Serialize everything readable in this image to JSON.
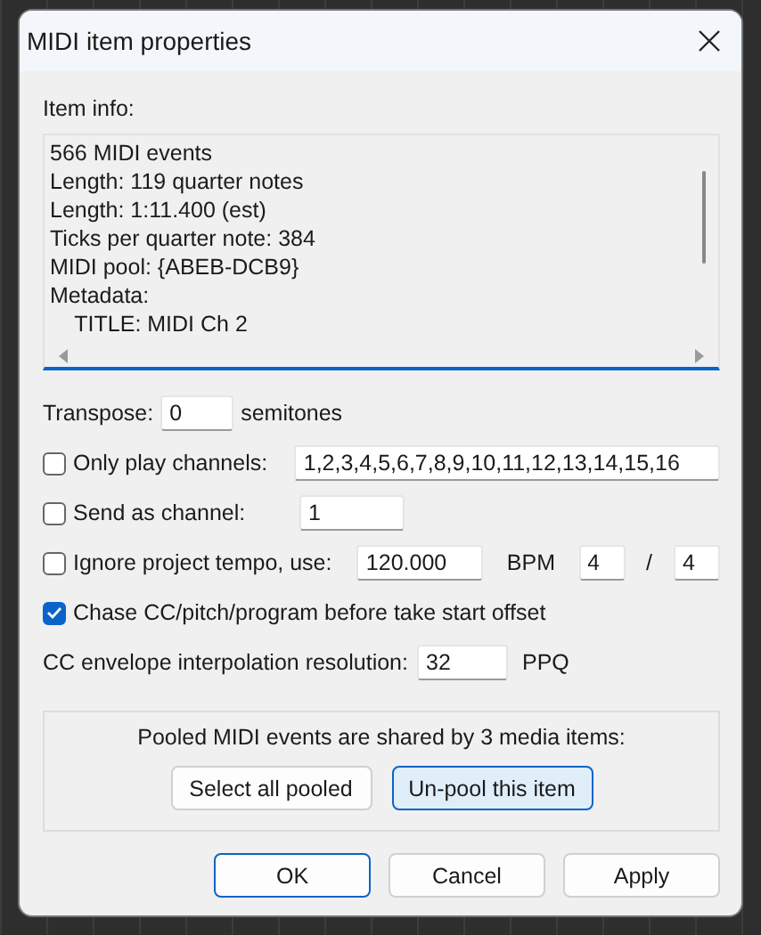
{
  "window": {
    "title": "MIDI item properties"
  },
  "item_info": {
    "label": "Item info:",
    "lines": [
      "566 MIDI events",
      "Length: 119 quarter notes",
      "Length: 1:11.400 (est)",
      "Ticks per quarter note: 384",
      "MIDI pool: {ABEB-DCB9}",
      "Metadata:",
      "    TITLE: MIDI Ch 2"
    ]
  },
  "transpose": {
    "label": "Transpose:",
    "value": "0",
    "unit": "semitones"
  },
  "options": [
    {
      "kind": "field",
      "checked": false,
      "label": "Only play channels:",
      "value": "1,2,3,4,5,6,7,8,9,10,11,12,13,14,15,16"
    },
    {
      "kind": "field",
      "checked": false,
      "label": "Send as channel:",
      "value": "1"
    },
    {
      "kind": "tempo",
      "checked": false,
      "label": "Ignore project tempo, use:",
      "bpm": "120.000",
      "bpm_unit": "BPM",
      "numerator": "4",
      "separator": "/",
      "denominator": "4"
    },
    {
      "kind": "plain",
      "checked": true,
      "label": "Chase CC/pitch/program before take start offset"
    }
  ],
  "cc_resolution": {
    "label": "CC envelope interpolation resolution:",
    "value": "32",
    "unit": "PPQ"
  },
  "pool": {
    "message": "Pooled MIDI events are shared by 3 media items:",
    "buttons": [
      {
        "label": "Select all pooled",
        "highlighted": false
      },
      {
        "label": "Un-pool this item",
        "highlighted": true
      }
    ]
  },
  "buttons": [
    {
      "label": "OK",
      "default": true
    },
    {
      "label": "Cancel",
      "default": false
    },
    {
      "label": "Apply",
      "default": false
    }
  ]
}
